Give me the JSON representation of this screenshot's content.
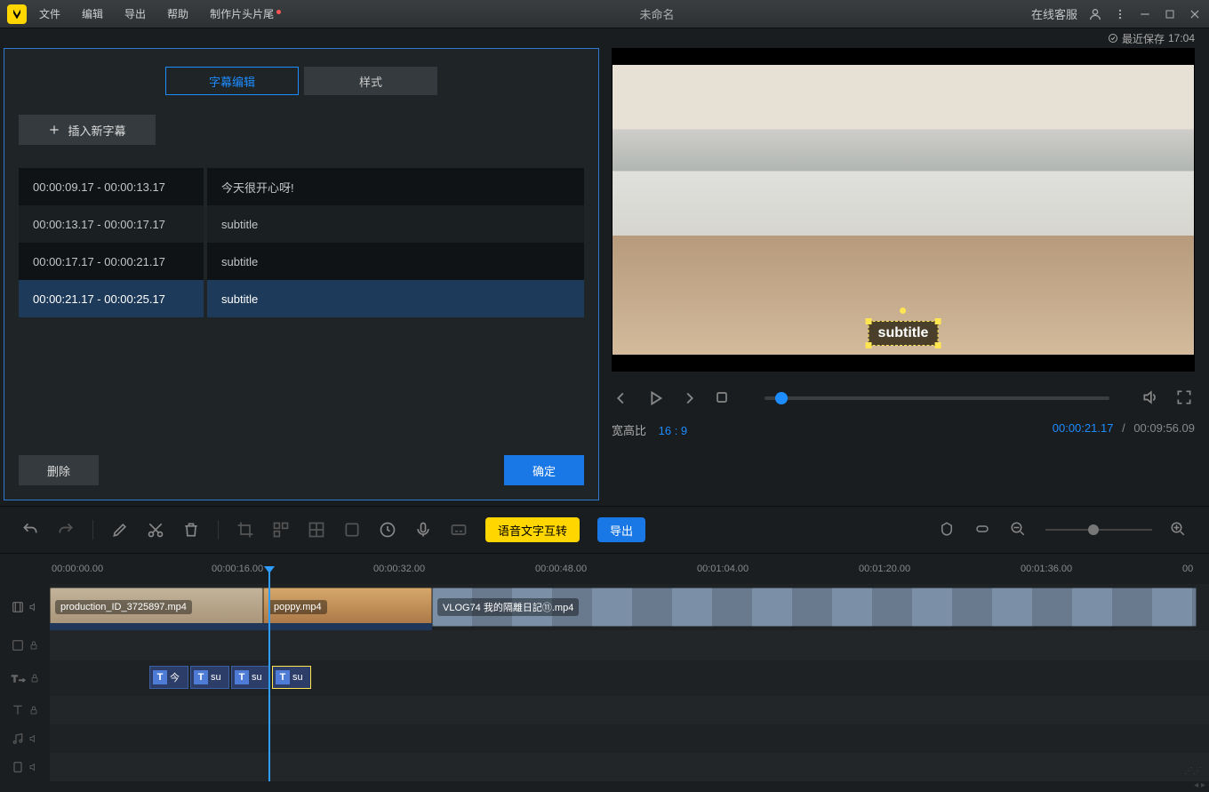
{
  "app": {
    "title": "未命名",
    "online_service": "在线客服"
  },
  "menu": {
    "file": "文件",
    "edit": "编辑",
    "export": "导出",
    "help": "帮助",
    "titles": "制作片头片尾"
  },
  "save": {
    "label": "最近保存",
    "time": "17:04"
  },
  "tabs": {
    "edit": "字幕编辑",
    "style": "样式"
  },
  "buttons": {
    "insert": "插入新字幕",
    "delete": "删除",
    "ok": "确定"
  },
  "subs": [
    {
      "time": "00:00:09.17 - 00:00:13.17",
      "text": "今天很开心呀!"
    },
    {
      "time": "00:00:13.17 - 00:00:17.17",
      "text": "subtitle"
    },
    {
      "time": "00:00:17.17 - 00:00:21.17",
      "text": "subtitle"
    },
    {
      "time": "00:00:21.17 - 00:00:25.17",
      "text": "subtitle"
    }
  ],
  "preview": {
    "overlay": "subtitle",
    "aspect_label": "宽高比",
    "aspect": "16 : 9",
    "current": "00:00:21.17",
    "duration": "00:09:56.09"
  },
  "toolbar": {
    "speech": "语音文字互转",
    "export": "导出"
  },
  "ruler": [
    "00:00:00.00",
    "00:00:16.00",
    "00:00:32.00",
    "00:00:48.00",
    "00:01:04.00",
    "00:01:20.00",
    "00:01:36.00"
  ],
  "clips": {
    "c1": "production_ID_3725897.mp4",
    "c2": "poppy.mp4",
    "c3": "VLOG74 我的隔離日記⑪.mp4"
  },
  "sublabels": {
    "a": "今",
    "b": "su",
    "c": "su",
    "d": "su"
  }
}
